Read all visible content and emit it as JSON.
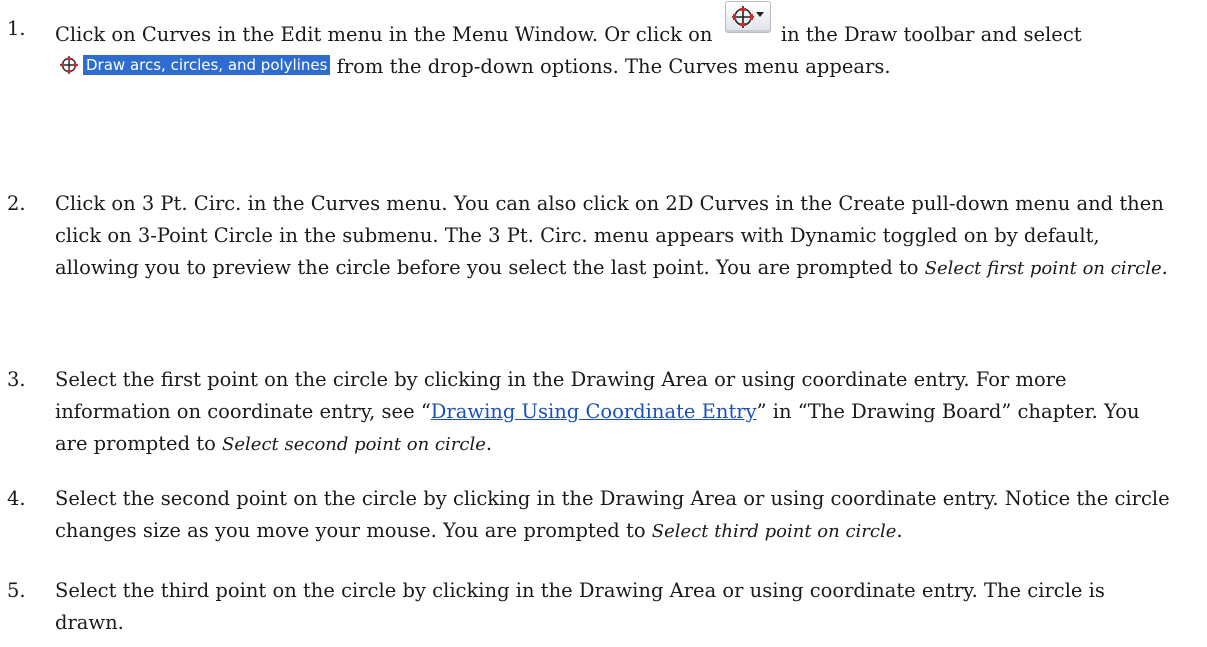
{
  "steps": [
    {
      "number": "1.",
      "part_a": "Click on Curves in the Edit menu in the Menu Window. Or click on",
      "part_b": "in the Draw toolbar and select",
      "menu_label": "Draw arcs, circles, and polylines",
      "part_c": "from the drop-down options. The Curves menu appears."
    },
    {
      "number": "2.",
      "text": "Click on 3 Pt. Circ. in the Curves menu. You can also click on 2D Curves in the Create pull-down menu and then click on 3-Point Circle in the submenu. The 3 Pt. Circ. menu appears with Dynamic toggled on by default, allowing you to preview the circle before you select the last point. You are prompted to",
      "prompt": "Select first point on circle",
      "end": "."
    },
    {
      "number": "3.",
      "text": "Select the first point on the circle by clicking in the Drawing Area or using coordinate entry. For more information on coordinate entry, see “",
      "link": "Drawing Using Coordinate Entry",
      "text_b": "” in “The Drawing Board” chapter. You are prompted to",
      "prompt": "Select second point on circle",
      "end": "."
    },
    {
      "number": "4.",
      "text": "Select the second point on the circle by clicking in the Drawing Area or using coordinate entry. Notice the circle changes size as you move your mouse. You are prompted to",
      "prompt": "Select third point on circle",
      "end": "."
    },
    {
      "number": "5.",
      "text": "Select the third point on the circle by clicking in the Drawing Area or using coordinate entry. The circle is drawn."
    }
  ],
  "icons": {
    "toolbar_button": "circle-crosshair-dropdown-icon",
    "menu_item_icon": "circle-crosshair-icon"
  },
  "colors": {
    "link": "#1a4fc0",
    "menu_highlight": "#2f6ccf",
    "icon_red": "#d22a2a"
  }
}
